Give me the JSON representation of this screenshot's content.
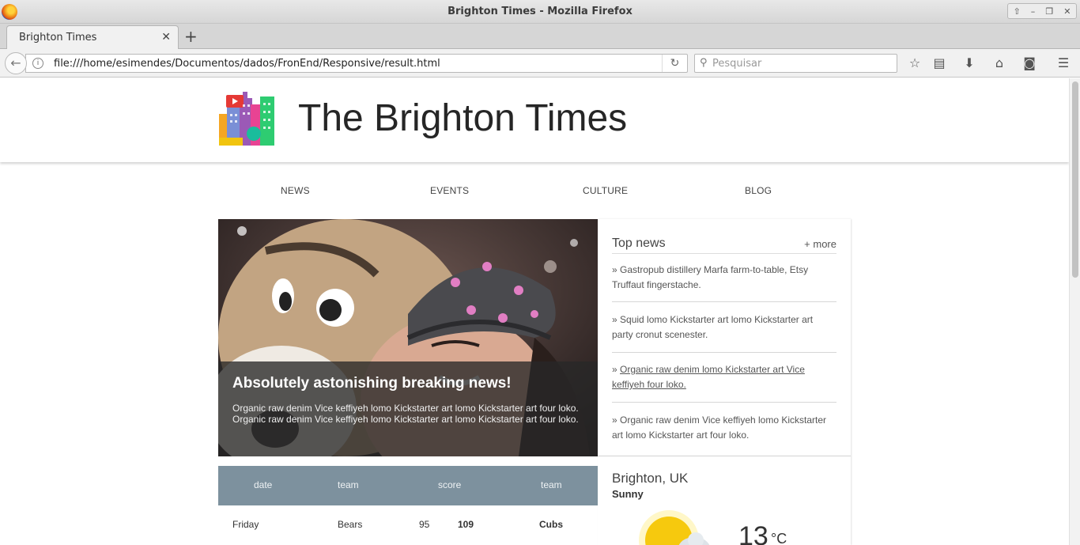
{
  "window": {
    "title": "Brighton Times - Mozilla Firefox",
    "controls": [
      "up-icon",
      "minimize-icon",
      "restore-icon",
      "close-icon"
    ]
  },
  "tabs": [
    {
      "title": "Brighton Times",
      "active": true
    }
  ],
  "toolbar": {
    "url": "file:///home/esimendes/Documentos/dados/FronEnd/Responsive/result.html",
    "search_placeholder": "Pesquisar",
    "icons": [
      "back-icon",
      "info-icon",
      "reload-icon",
      "search-icon",
      "bookmark-star-icon",
      "reading-list-icon",
      "download-icon",
      "home-icon",
      "pocket-icon",
      "menu-icon"
    ]
  },
  "site": {
    "title": "The Brighton Times",
    "nav": [
      "NEWS",
      "EVENTS",
      "CULTURE",
      "BLOG"
    ]
  },
  "hero": {
    "title": "Absolutely astonishing breaking news!",
    "text": "Organic raw denim Vice keffiyeh lomo Kickstarter art lomo Kickstarter art four loko. Organic raw denim Vice keffiyeh lomo Kickstarter art lomo Kickstarter art four loko."
  },
  "top_news": {
    "title": "Top news",
    "more": "+ more",
    "items": [
      {
        "prefix": "»",
        "text": "Gastropub distillery Marfa farm-to-table, Etsy Truffaut fingerstache.",
        "linked": false
      },
      {
        "prefix": "»",
        "text": "Squid lomo Kickstarter art lomo Kickstarter art party cronut scenester.",
        "linked": false
      },
      {
        "prefix": "»",
        "text": "Organic raw denim lomo Kickstarter art Vice keffiyeh four loko.",
        "linked": true
      },
      {
        "prefix": "»",
        "text": "Organic raw denim Vice keffiyeh lomo Kickstarter art lomo Kickstarter art four loko.",
        "linked": false
      }
    ]
  },
  "scores": {
    "headers": [
      "date",
      "team",
      "score",
      "team"
    ],
    "rows": [
      {
        "date": "Friday",
        "team1": "Bears",
        "score1": "95",
        "score2": "109",
        "team2": "Cubs"
      }
    ]
  },
  "weather": {
    "location": "Brighton, UK",
    "condition": "Sunny",
    "temperature": "13",
    "unit": "°C"
  }
}
